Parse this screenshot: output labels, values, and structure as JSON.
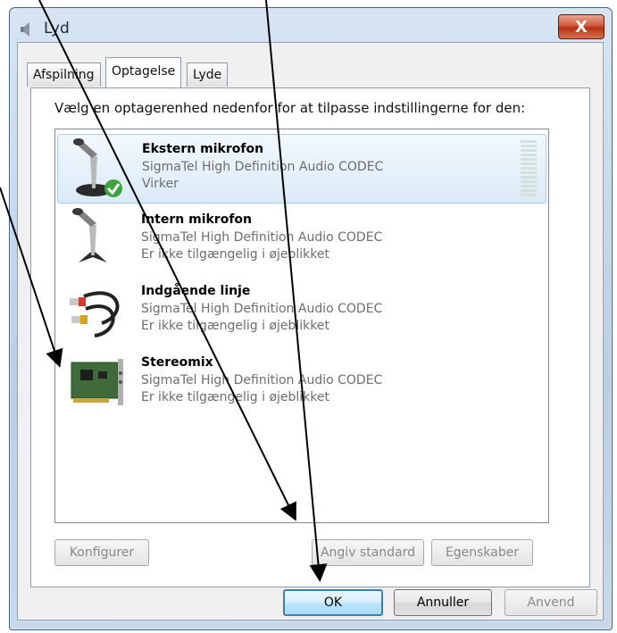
{
  "window": {
    "title": "Lyd",
    "close_label": "X"
  },
  "tabs": [
    {
      "label": "Afspilning",
      "active": false
    },
    {
      "label": "Optagelse",
      "active": true
    },
    {
      "label": "Lyde",
      "active": false
    }
  ],
  "instruction": "Vælg en optagerenhed nedenfor for at tilpasse indstillingerne for den:",
  "devices": [
    {
      "name": "Ekstern mikrofon",
      "driver": "SigmaTel High Definition Audio CODEC",
      "status": "Virker",
      "icon": "microphone-default-icon",
      "selected": true
    },
    {
      "name": "Intern mikrofon",
      "driver": "SigmaTel High Definition Audio CODEC",
      "status": "Er ikke tilgængelig i øjeblikket",
      "icon": "microphone-icon",
      "selected": false
    },
    {
      "name": "Indgående linje",
      "driver": "SigmaTel High Definition Audio CODEC",
      "status": "Er ikke tilgængelig i øjeblikket",
      "icon": "line-in-cable-icon",
      "selected": false
    },
    {
      "name": "Stereomix",
      "driver": "SigmaTel High Definition Audio CODEC",
      "status": "Er ikke tilgængelig i øjeblikket",
      "icon": "sound-card-icon",
      "selected": false
    }
  ],
  "buttons": {
    "configure": "Konfigurer",
    "set_default": "Angiv standard",
    "properties": "Egenskaber",
    "ok": "OK",
    "cancel": "Annuller",
    "apply": "Anvend"
  },
  "colors": {
    "selection": "#dbeaf8",
    "default_button_border": "#3c7fb1",
    "close_button": "#c1442a"
  }
}
